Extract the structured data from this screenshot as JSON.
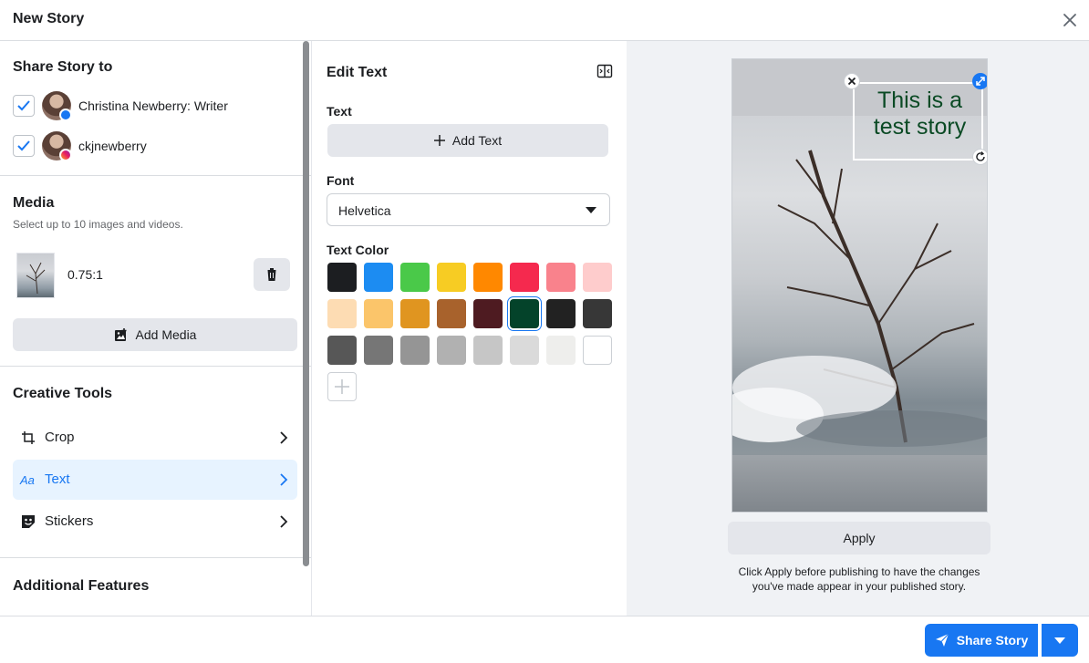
{
  "window": {
    "title": "New Story"
  },
  "share_to": {
    "title": "Share Story to",
    "accounts": [
      {
        "name": "Christina Newberry: Writer",
        "platform": "facebook",
        "checked": true
      },
      {
        "name": "ckjnewberry",
        "platform": "instagram",
        "checked": true
      }
    ]
  },
  "media": {
    "title": "Media",
    "subtitle": "Select up to 10 images and videos.",
    "items": [
      {
        "aspect_ratio": "0.75:1"
      }
    ],
    "add_label": "Add Media"
  },
  "creative_tools": {
    "title": "Creative Tools",
    "items": [
      {
        "label": "Crop",
        "icon": "crop-icon",
        "active": false
      },
      {
        "label": "Text",
        "icon": "text-icon",
        "active": true
      },
      {
        "label": "Stickers",
        "icon": "sticker-icon",
        "active": false
      }
    ]
  },
  "additional": {
    "title": "Additional Features"
  },
  "edit_text": {
    "title": "Edit Text",
    "text_label": "Text",
    "add_text_label": "Add Text",
    "font_label": "Font",
    "font_value": "Helvetica",
    "color_label": "Text Color",
    "colors": [
      "#1c1e21",
      "#1c8cf2",
      "#4ac949",
      "#f7cc23",
      "#ff8800",
      "#f5294e",
      "#f9828c",
      "#fecccc",
      "#fddcb3",
      "#fbc56a",
      "#e09520",
      "#a8622c",
      "#4e1b21",
      "#04432a",
      "#222222",
      "#373737",
      "#575757",
      "#767676",
      "#959595",
      "#b1b1b1",
      "#c6c6c6",
      "#dadada",
      "#eeeeec",
      "#ffffff"
    ],
    "selected_color": "#04432a"
  },
  "preview": {
    "story_text": "This is a test story",
    "text_color": "#0a4a24",
    "apply_label": "Apply",
    "note": "Click Apply before publishing to have the changes you've made appear in your published story."
  },
  "footer": {
    "share_label": "Share Story"
  }
}
